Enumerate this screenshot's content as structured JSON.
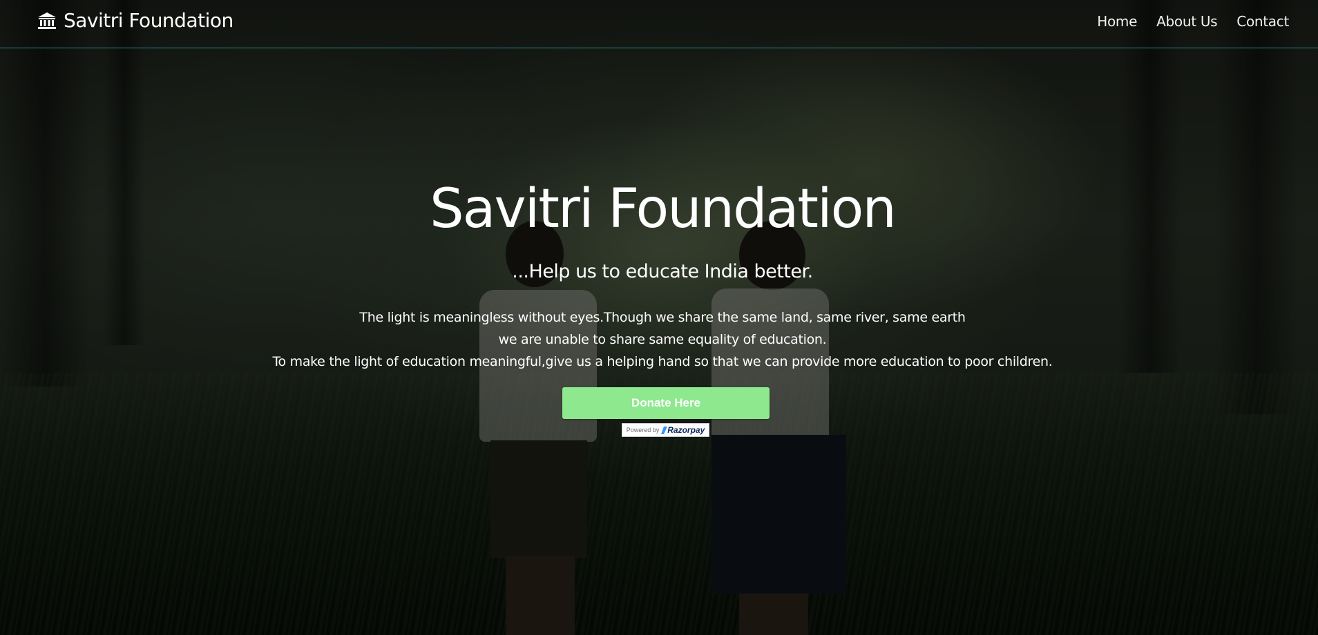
{
  "navbar": {
    "brand_name": "Savitri Foundation",
    "brand_icon": "bank-icon",
    "links": [
      {
        "label": "Home"
      },
      {
        "label": "About Us"
      },
      {
        "label": "Contact"
      }
    ]
  },
  "hero": {
    "title": "Savitri Foundation",
    "tagline": "...Help us to educate India better.",
    "body_lines": [
      "The light is meaningless without eyes.Though we share the same land, same river, same earth",
      "we are unable to share same equality of education.",
      "To make the light of education meaningful,give us a helping hand so that we can provide more education to poor children."
    ],
    "donate_label": "Donate Here",
    "payment_badge": {
      "powered_text": "Powered by",
      "provider": "Razorpay"
    }
  },
  "colors": {
    "donate_button": "#8ee88e",
    "navbar_border": "#2a8a94",
    "text": "#ffffff"
  }
}
